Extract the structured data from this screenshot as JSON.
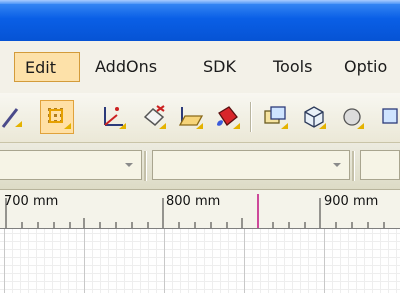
{
  "menu": {
    "items": [
      {
        "label": "Edit",
        "selected": true
      },
      {
        "label": "AddOns"
      },
      {
        "label": "SDK"
      },
      {
        "label": "Tools"
      },
      {
        "label": "Optio"
      }
    ]
  },
  "toolbar": {
    "buttons": [
      {
        "icon": "magic-wand-icon"
      },
      {
        "icon": "grid-snap-icon",
        "active": true
      },
      {
        "icon": "axis-icon"
      },
      {
        "icon": "eraser-icon"
      },
      {
        "icon": "open-folder-icon"
      },
      {
        "icon": "paint-bucket-icon"
      },
      {
        "icon": "layers-icon"
      },
      {
        "icon": "3d-box-icon"
      },
      {
        "icon": "overflow-icon"
      }
    ]
  },
  "combos": [
    {
      "value": ""
    },
    {
      "value": ""
    },
    {
      "value": ""
    }
  ],
  "ruler": {
    "labels": [
      "700 mm",
      "800 mm",
      "900 mm"
    ],
    "marker_color": "#c01080"
  },
  "colors": {
    "accent": "#fde1a9",
    "accent_border": "#d39b3a",
    "titlebar": "#0a5fe6"
  }
}
